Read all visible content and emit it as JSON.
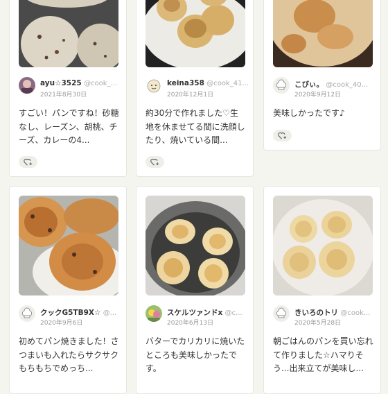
{
  "cards": [
    {
      "name": "ayu☆3525",
      "handle": "@cook_...",
      "date": "2021年8月30日",
      "comment": "すごい！パンですね！砂糖なし、レーズン、胡桃、チーズ、カレーの4..."
    },
    {
      "name": "keina358",
      "handle": "@cook_41...",
      "date": "2020年12月1日",
      "comment": "約30分で作れました♡生地を休ませてる間に洗顔したり、焼いている間..."
    },
    {
      "name": "こびぃ。",
      "handle": "@cook_40...",
      "date": "2020年9月12日",
      "comment": "美味しかったです♪"
    },
    {
      "name": "クックG5TB9X☆",
      "handle": "@...",
      "date": "2020年9月6日",
      "comment": "初めてパン焼きました！さつまいも入れたらサクサクもちもちでめっち..."
    },
    {
      "name": "スケルツァンドx",
      "handle": "@c...",
      "date": "2020年6月13日",
      "comment": "バターでカリカリに焼いたところも美味しかったです。"
    },
    {
      "name": "きいろのトリ",
      "handle": "@cook...",
      "date": "2020年5月28日",
      "comment": "朝ごはんのパンを買い忘れて作りました☆ハマりそう...出来立てが美味し..."
    }
  ],
  "icons": {
    "like": "heart-plus-icon",
    "default_avatar": "chef-hat-icon"
  }
}
